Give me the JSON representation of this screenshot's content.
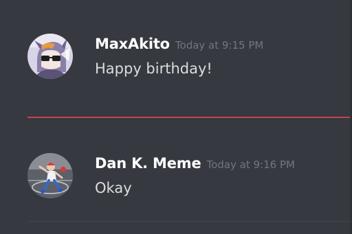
{
  "messages": [
    {
      "author": "MaxAkito",
      "timestamp": "Today at 9:15 PM",
      "content": "Happy birthday!",
      "avatar_icon": "anime-character-with-sunglasses-avatar"
    },
    {
      "author": "Dan K. Meme",
      "timestamp": "Today at 9:16 PM",
      "content": "Okay",
      "avatar_icon": "dancing-character-on-court-avatar"
    }
  ],
  "colors": {
    "background": "#36393f",
    "username": "#ffffff",
    "timestamp": "#72767d",
    "message_text": "#dcddde",
    "new_messages_divider": "#c3454d"
  }
}
